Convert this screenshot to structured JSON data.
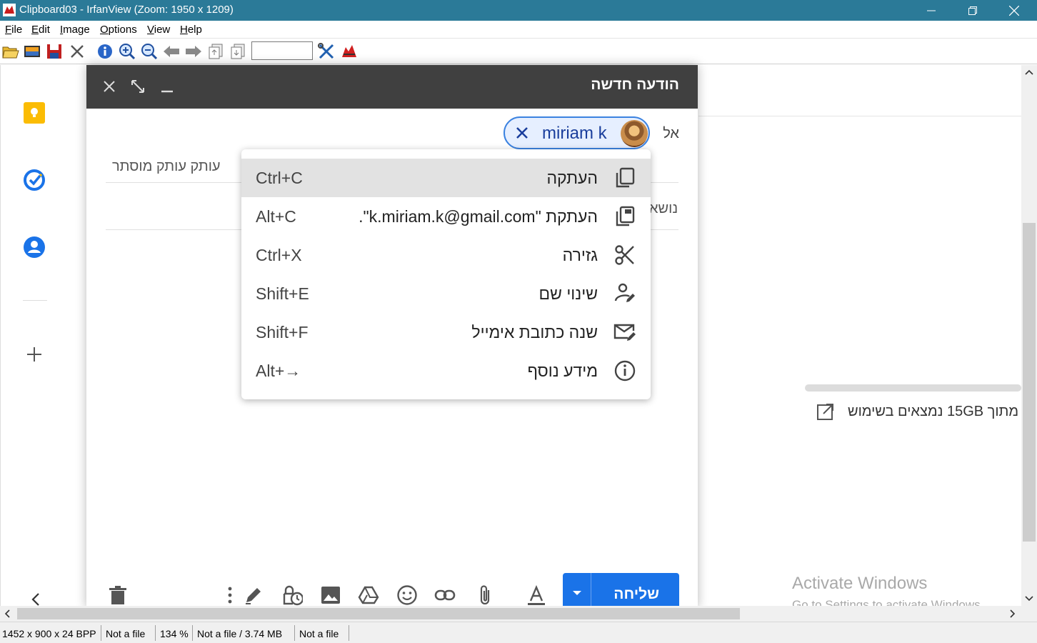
{
  "window": {
    "title": "Clipboard03 - IrfanView (Zoom: 1950 x 1209)"
  },
  "menu": [
    "File",
    "Edit",
    "Image",
    "Options",
    "View",
    "Help"
  ],
  "menu_underline": [
    "F",
    "E",
    "I",
    "O",
    "V",
    "H"
  ],
  "menu_rest": [
    "ile",
    "dit",
    "mage",
    "ptions",
    "iew",
    "elp"
  ],
  "toolbar": {
    "zoom_value": ""
  },
  "status": {
    "dims": "1452 x 900 x 24 BPP",
    "file1": "Not a file",
    "zoom": "134 %",
    "file_size": "Not a file / 3.74 MB",
    "file2": "Not a file"
  },
  "compose": {
    "title": "הודעה חדשה",
    "to_label": "אל",
    "recipient": "miriam k",
    "cc_bcc": "עותק עותק מוסתר",
    "subject_label": "נושא",
    "send_label": "שליחה"
  },
  "context_menu": [
    {
      "label": "העתקה",
      "shortcut": "Ctrl+C",
      "icon": "copy-icon"
    },
    {
      "label": "העתקת \"k.miriam.k@gmail.com\".",
      "shortcut": "Alt+C",
      "icon": "copy-email-icon"
    },
    {
      "label": "גזירה",
      "shortcut": "Ctrl+X",
      "icon": "scissors-icon"
    },
    {
      "label": "שינוי שם",
      "shortcut": "Shift+E",
      "icon": "edit-person-icon"
    },
    {
      "label": "שנה כתובת אימייל",
      "shortcut": "Shift+F",
      "icon": "edit-mail-icon"
    },
    {
      "label": "מידע נוסף",
      "shortcut": "Alt+→",
      "icon": "info-icon"
    }
  ],
  "right_panel": {
    "storage": "מתוך 15GB נמצאים בשימוש"
  },
  "watermark": {
    "line1": "Activate Windows",
    "line2": "Go to Settings to activate Windows."
  },
  "colors": {
    "titlebar": "#2b7a98",
    "send_button": "#1a73e8",
    "compose_header": "#404040",
    "chip_border": "#3b82e0"
  }
}
